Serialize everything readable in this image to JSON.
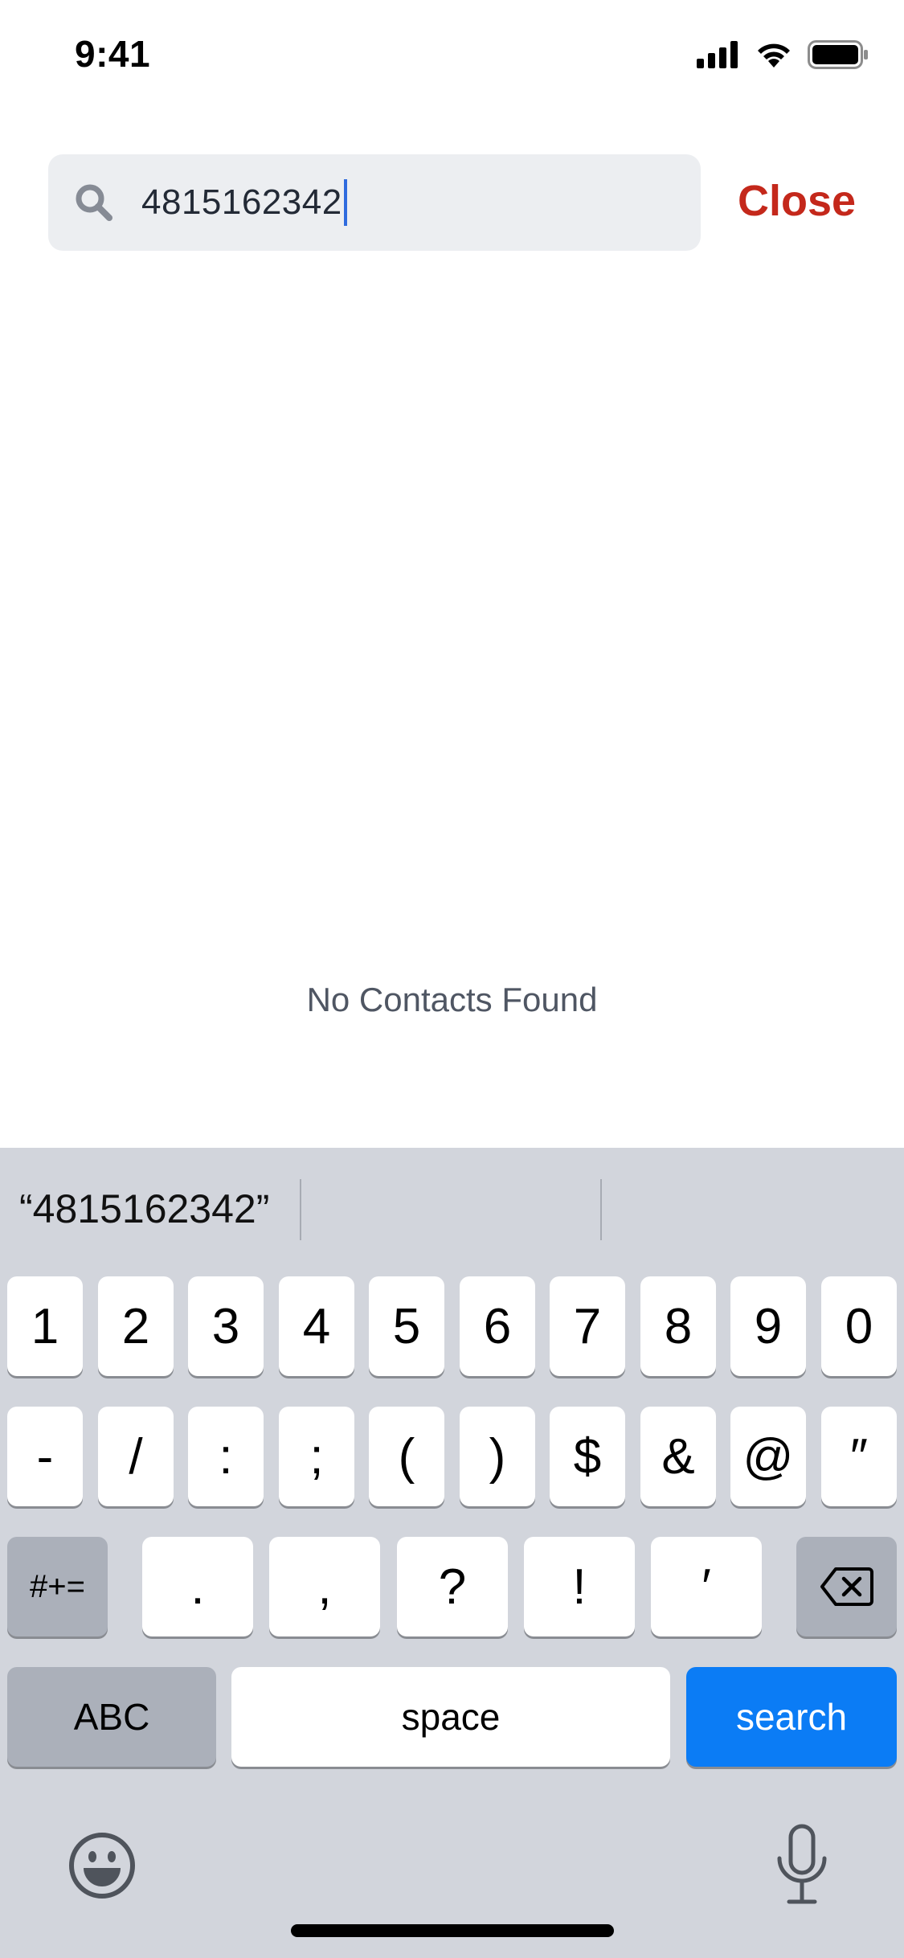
{
  "status_bar": {
    "time": "9:41",
    "icons": [
      "cellular-signal-icon",
      "wifi-icon",
      "battery-icon"
    ]
  },
  "search": {
    "value": "4815162342",
    "icon": "search-icon",
    "close_label": "Close"
  },
  "results": {
    "empty_message": "No Contacts Found"
  },
  "keyboard": {
    "suggestion": "“4815162342”",
    "row1": [
      "1",
      "2",
      "3",
      "4",
      "5",
      "6",
      "7",
      "8",
      "9",
      "0"
    ],
    "row2": [
      "-",
      "/",
      ":",
      ";",
      "(",
      ")",
      "$",
      "&",
      "@",
      "″"
    ],
    "row3": {
      "switch_label": "#+=",
      "keys": [
        ".",
        ",",
        "?",
        "!",
        "′"
      ],
      "delete_icon": "backspace-icon"
    },
    "row4": {
      "abc_label": "ABC",
      "space_label": "space",
      "search_label": "search"
    },
    "bottom_icons": [
      "emoji-icon",
      "microphone-icon"
    ]
  },
  "colors": {
    "accent_close": "#c4281b",
    "search_key": "#0b7cf5",
    "caret": "#2f6bde",
    "keyboard_bg": "#d2d5dc"
  }
}
